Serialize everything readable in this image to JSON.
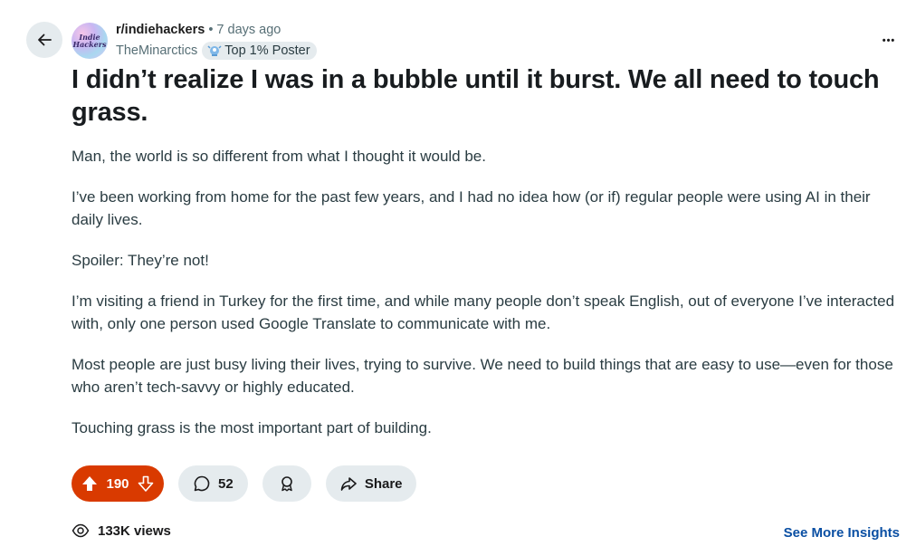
{
  "post": {
    "subreddit": "r/indiehackers",
    "separator": "•",
    "time_ago": "7 days ago",
    "author": "TheMinarctics",
    "flair": "Top 1% Poster",
    "avatar_text": "Indie Hackers",
    "title": "I didn’t realize I was in a bubble until it burst. We all need to touch grass.",
    "paragraphs": [
      "Man, the world is so different from what I thought it would be.",
      "I’ve been working from home for the past few years, and I had no idea how (or if) regular people were using AI in their daily lives.",
      "Spoiler: They’re not!",
      "I’m visiting a friend in Turkey for the first time, and while many people don’t speak English, out of everyone I’ve interacted with, only one person used Google Translate to communicate with me.",
      "Most people are just busy living their lives, trying to survive. We need to build things that are easy to use—even for those who aren’t tech-savvy or highly educated.",
      "Touching grass is the most important part of building."
    ]
  },
  "actions": {
    "vote_count": "190",
    "comment_count": "52",
    "share_label": "Share",
    "more_label": "•••"
  },
  "footer": {
    "views": "133K views",
    "insights_label": "See More Insights"
  },
  "icons": {
    "back": "arrow-left-icon",
    "more": "more-horizontal-icon",
    "upvote": "arrow-up-icon",
    "downvote": "arrow-down-icon",
    "comment": "comment-bubble-icon",
    "award": "award-icon",
    "share": "share-arrow-icon",
    "views": "eye-views-icon",
    "flair": "trophy-icon"
  },
  "colors": {
    "upvote_active": "#d93a00",
    "pill_bg": "#e5ebee",
    "link": "#0a4fa3"
  }
}
